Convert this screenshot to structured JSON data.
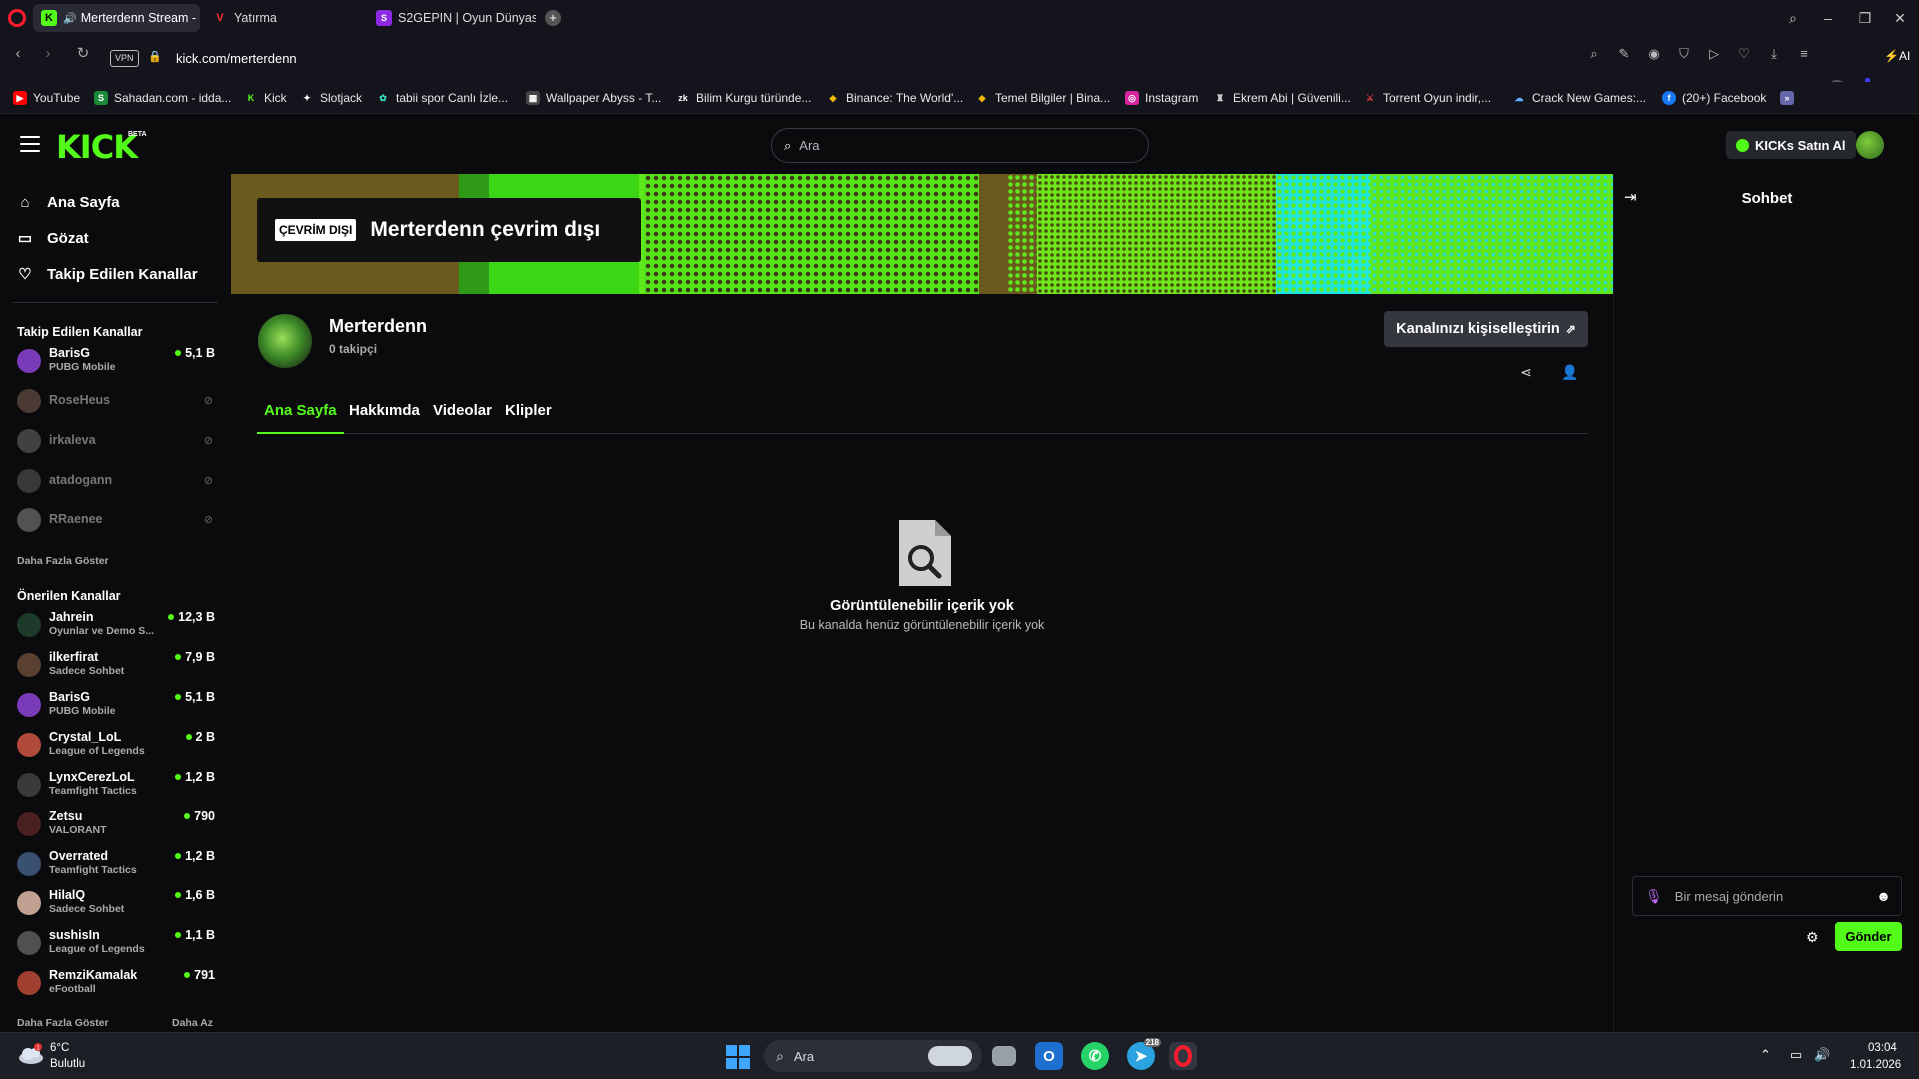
{
  "browser": {
    "tabs": [
      {
        "label": "Merterdenn Stream - K",
        "favicon": "K",
        "active": true
      },
      {
        "label": "Yatırma",
        "favicon": "V",
        "active": false
      },
      {
        "label": "S2GEPIN | Oyun Dünyasın",
        "favicon": "S",
        "active": false
      }
    ],
    "new_tab_icon": "plus-icon",
    "url": "kick.com/merterdenn",
    "vpn_label": "VPN",
    "ai_label": "AI",
    "bookmarks": [
      {
        "label": "YouTube",
        "favicon": "youtube-icon"
      },
      {
        "label": "Sahadan.com - idda...",
        "favicon": "sahadan-icon"
      },
      {
        "label": "Kick",
        "favicon": "kick-icon"
      },
      {
        "label": "Slotjack",
        "favicon": "slotjack-icon"
      },
      {
        "label": "tabii spor Canlı İzle...",
        "favicon": "tabii-icon"
      },
      {
        "label": "Wallpaper Abyss - T...",
        "favicon": "wallpaper-icon"
      },
      {
        "label": "Bilim Kurgu türünde...",
        "favicon": "zk-icon"
      },
      {
        "label": "Binance: The World'...",
        "favicon": "binance-icon"
      },
      {
        "label": "Temel Bilgiler | Bina...",
        "favicon": "binance-icon"
      },
      {
        "label": "Instagram",
        "favicon": "instagram-icon"
      },
      {
        "label": "Ekrem Abi | Güvenili...",
        "favicon": "ekrem-icon"
      },
      {
        "label": "Torrent Oyun indir,...",
        "favicon": "torrent-icon"
      },
      {
        "label": "Crack New Games:...",
        "favicon": "crack-icon"
      },
      {
        "label": "(20+) Facebook",
        "favicon": "facebook-icon"
      }
    ]
  },
  "kick": {
    "logo": "KICK",
    "logo_badge": "BETA",
    "search_placeholder": "Ara",
    "buy_kicks_label": "KICKs Satın Al",
    "accent": "#53fc18",
    "sidebar": {
      "nav": [
        {
          "label": "Ana Sayfa",
          "icon": "home-icon"
        },
        {
          "label": "Gözat",
          "icon": "browse-icon"
        },
        {
          "label": "Takip Edilen Kanallar",
          "icon": "heart-icon"
        }
      ],
      "following_heading": "Takip Edilen Kanallar",
      "following": [
        {
          "name": "BarisG",
          "category": "PUBG Mobile",
          "viewers": "5,1 B",
          "live": true,
          "avatar_color": "#7a3bb8"
        },
        {
          "name": "RoseHeus",
          "live": false,
          "avatar_color": "#8a6a5a"
        },
        {
          "name": "irkaleva",
          "live": false,
          "avatar_color": "#777777"
        },
        {
          "name": "atadogann",
          "live": false,
          "avatar_color": "#666666"
        },
        {
          "name": "RRaenee",
          "live": false,
          "avatar_color": "#999999"
        }
      ],
      "following_more": "Daha Fazla Göster",
      "recommended_heading": "Önerilen Kanallar",
      "recommended": [
        {
          "name": "Jahrein",
          "category": "Oyunlar ve Demo S...",
          "viewers": "12,3 B",
          "avatar_color": "#1e3a2a"
        },
        {
          "name": "ilkerfirat",
          "category": "Sadece Sohbet",
          "viewers": "7,9 B",
          "avatar_color": "#5a4030"
        },
        {
          "name": "BarisG",
          "category": "PUBG Mobile",
          "viewers": "5,1 B",
          "avatar_color": "#7a3bb8"
        },
        {
          "name": "Crystal_LoL",
          "category": "League of Legends",
          "viewers": "2 B",
          "avatar_color": "#b04a3a"
        },
        {
          "name": "LynxCerezLoL",
          "category": "Teamfight Tactics",
          "viewers": "1,2 B",
          "avatar_color": "#3a3a3a"
        },
        {
          "name": "Zetsu",
          "category": "VALORANT",
          "viewers": "790",
          "avatar_color": "#4a2020"
        },
        {
          "name": "Overrated",
          "category": "Teamfight Tactics",
          "viewers": "1,2 B",
          "avatar_color": "#3a5070"
        },
        {
          "name": "HilalQ",
          "category": "Sadece Sohbet",
          "viewers": "1,6 B",
          "avatar_color": "#c0a090"
        },
        {
          "name": "sushisIn",
          "category": "League of Legends",
          "viewers": "1,1 B",
          "avatar_color": "#505050"
        },
        {
          "name": "RemziKamalak",
          "category": "eFootball",
          "viewers": "791",
          "avatar_color": "#a04030"
        }
      ],
      "recommended_more": "Daha Fazla Göster",
      "recommended_less": "Daha Az"
    },
    "banner": {
      "offline_badge": "ÇEVRİM DIŞI",
      "offline_title": "Merterdenn çevrim dışı"
    },
    "channel": {
      "name": "Merterdenn",
      "followers": "0 takipçi",
      "customize_label": "Kanalınızı kişiselleştirin",
      "tabs": [
        "Ana Sayfa",
        "Hakkımda",
        "Videolar",
        "Klipler"
      ],
      "active_tab": "Ana Sayfa",
      "empty_title": "Görüntülenebilir içerik yok",
      "empty_subtitle": "Bu kanalda henüz görüntülenebilir içerik yok"
    },
    "chat": {
      "title": "Sohbet",
      "input_placeholder": "Bir mesaj gönderin",
      "send_label": "Gönder"
    }
  },
  "taskbar": {
    "weather_temp": "6°C",
    "weather_desc": "Bulutlu",
    "weather_badge": "1",
    "search_placeholder": "Ara",
    "clock_time": "03:04",
    "clock_date": "1.01.2026",
    "telegram_badge": "218"
  }
}
